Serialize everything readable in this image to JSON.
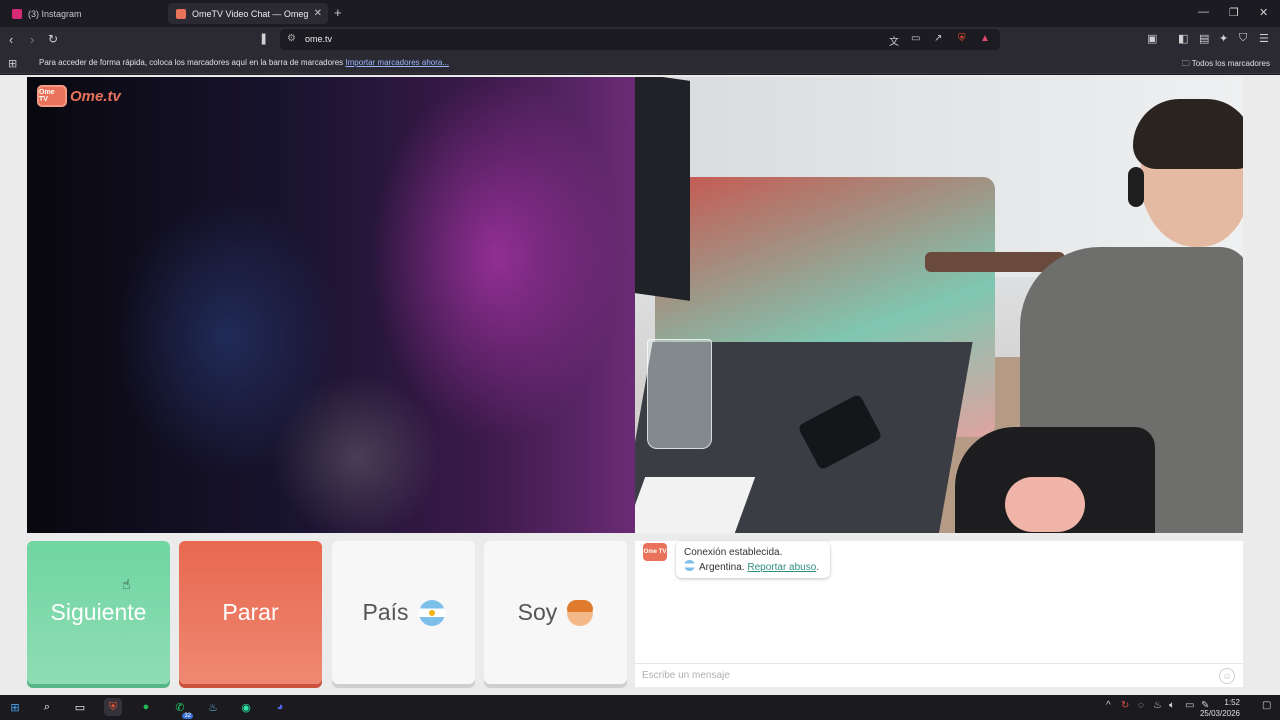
{
  "browser": {
    "tabs": [
      {
        "title": "(3) Instagram",
        "color": "#d62976"
      },
      {
        "title": "OmeTV Video Chat — Omeg",
        "color": "#e8735a"
      }
    ],
    "url": "ome.tv",
    "bookmarks_hint": "Para acceder de forma rápida, coloca los marcadores aquí en la barra de marcadores",
    "bookmarks_import": "Importar marcadores ahora...",
    "bookmarks_all": "Todos los marcadores"
  },
  "page": {
    "logo_tv": "Ome TV",
    "logo_brand": "Ome.tv",
    "buttons": {
      "next": "Siguiente",
      "stop": "Parar",
      "country": "País",
      "gender": "Soy"
    },
    "chat": {
      "logo": "Ome TV",
      "status": "Conexión establecida.",
      "country": "Argentina.",
      "report": "Reportar abuso",
      "report_suffix": ".",
      "placeholder": "Escribe un mensaje"
    }
  },
  "taskbar": {
    "whatsapp_badge": "32",
    "time": "1:52",
    "date": "25/03/2026"
  }
}
